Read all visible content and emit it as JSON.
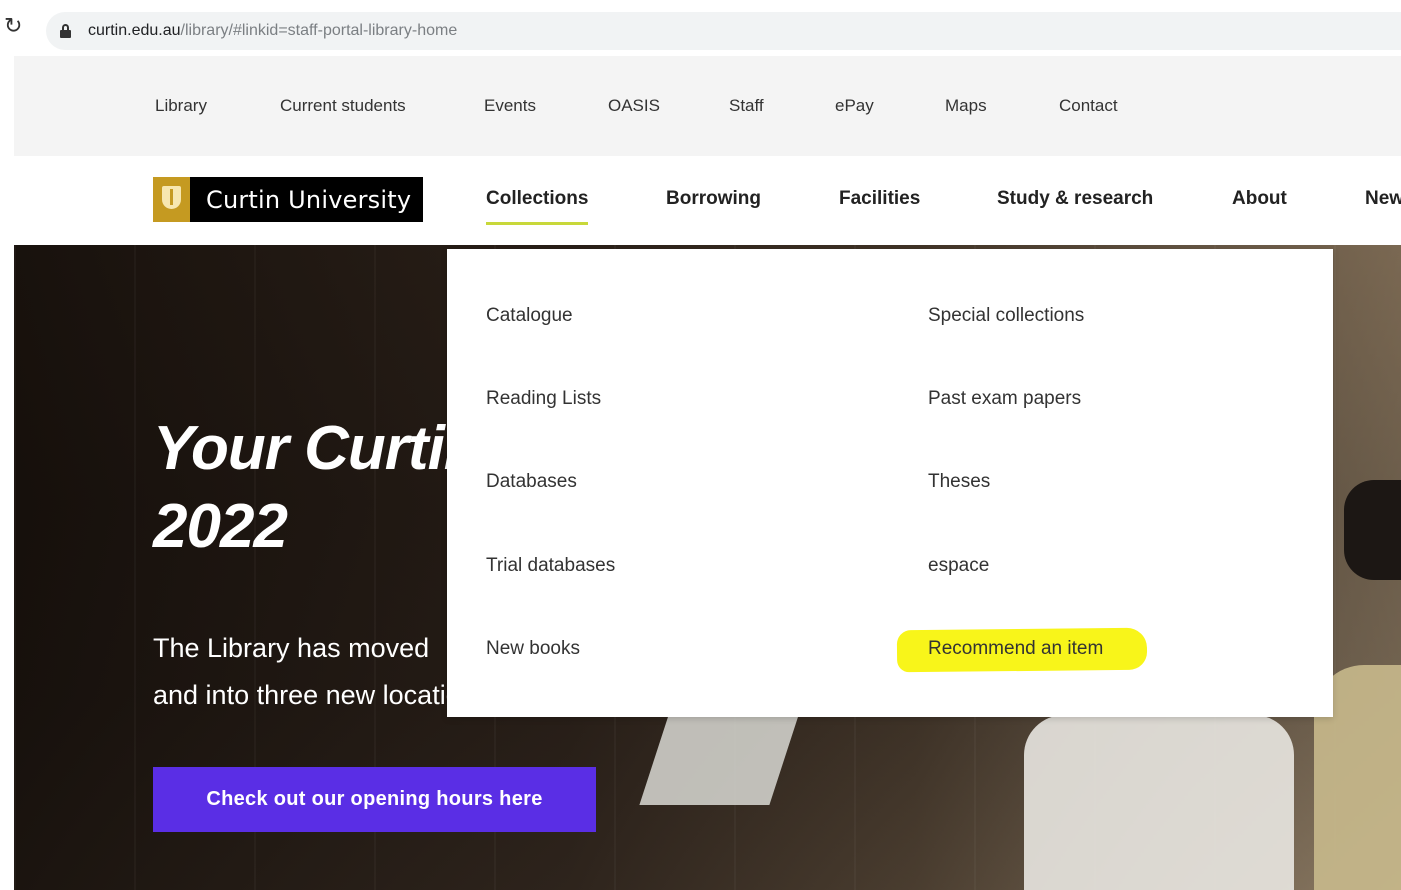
{
  "browser": {
    "url_host": "curtin.edu.au",
    "url_path": "/library/#linkid=staff-portal-library-home",
    "reload_icon": "reload-icon",
    "lock_icon": "lock-icon"
  },
  "utility_nav": [
    "Library",
    "Current students",
    "Events",
    "OASIS",
    "Staff",
    "ePay",
    "Maps",
    "Contact"
  ],
  "header": {
    "logo_text": "Curtin University",
    "main_nav": [
      "Collections",
      "Borrowing",
      "Facilities",
      "Study & research",
      "About",
      "New"
    ],
    "active": "Collections"
  },
  "hero": {
    "title_line1": "Your Curtin",
    "title_line2": "2022",
    "text_line1": "The Library has moved",
    "text_line2": "and into three new locations",
    "cta_label": "Check out our opening hours here",
    "cta_color": "#5a2ee5"
  },
  "dropdown": {
    "left_column": [
      "Catalogue",
      "Reading Lists",
      "Databases",
      "Trial databases",
      "New books"
    ],
    "right_column": [
      "Special collections",
      "Past exam papers",
      "Theses",
      "espace",
      "Recommend an item"
    ],
    "highlight_color": "#f8f51a"
  },
  "colors": {
    "accent_underline": "#c8d83a",
    "logo_gold": "#c59a21"
  }
}
